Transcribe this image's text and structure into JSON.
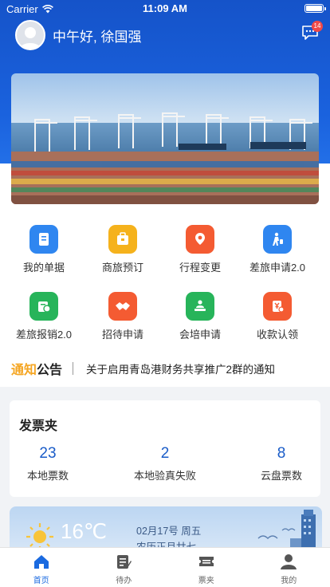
{
  "status_bar": {
    "carrier": "Carrier",
    "time": "11:09 AM"
  },
  "user": {
    "greeting": "中午好, 徐国强",
    "message_badge": "14"
  },
  "grid": [
    {
      "label": "我的单据",
      "icon": "document-icon",
      "color": "#2f86f0"
    },
    {
      "label": "商旅预订",
      "icon": "briefcase-icon",
      "color": "#f5b21c"
    },
    {
      "label": "行程变更",
      "icon": "location-pin-icon",
      "color": "#f45b32"
    },
    {
      "label": "差旅申请2.0",
      "icon": "traveler-icon",
      "color": "#2f86f0"
    },
    {
      "label": "差旅报销2.0",
      "icon": "reimbursement-icon",
      "color": "#27b45a"
    },
    {
      "label": "招待申请",
      "icon": "handshake-icon",
      "color": "#f45b32"
    },
    {
      "label": "会培申请",
      "icon": "meeting-icon",
      "color": "#27b45a"
    },
    {
      "label": "收款认领",
      "icon": "payment-icon",
      "color": "#f45b32"
    }
  ],
  "notice": {
    "title_a": "通知",
    "title_b": "公告",
    "text": "关于启用青岛港财务共享推广2群的通知"
  },
  "invoice": {
    "title": "发票夹",
    "stats": [
      {
        "value": "23",
        "label": "本地票数"
      },
      {
        "value": "2",
        "label": "本地验真失败"
      },
      {
        "value": "8",
        "label": "云盘票数"
      }
    ]
  },
  "weather": {
    "temperature": "16℃",
    "date": "02月17号  周五",
    "lunar": "农历正月廿七"
  },
  "tabs": [
    {
      "label": "首页",
      "icon": "home-icon",
      "active": true
    },
    {
      "label": "待办",
      "icon": "todo-icon",
      "active": false
    },
    {
      "label": "票夹",
      "icon": "ticket-icon",
      "active": false
    },
    {
      "label": "我的",
      "icon": "profile-icon",
      "active": false
    }
  ]
}
